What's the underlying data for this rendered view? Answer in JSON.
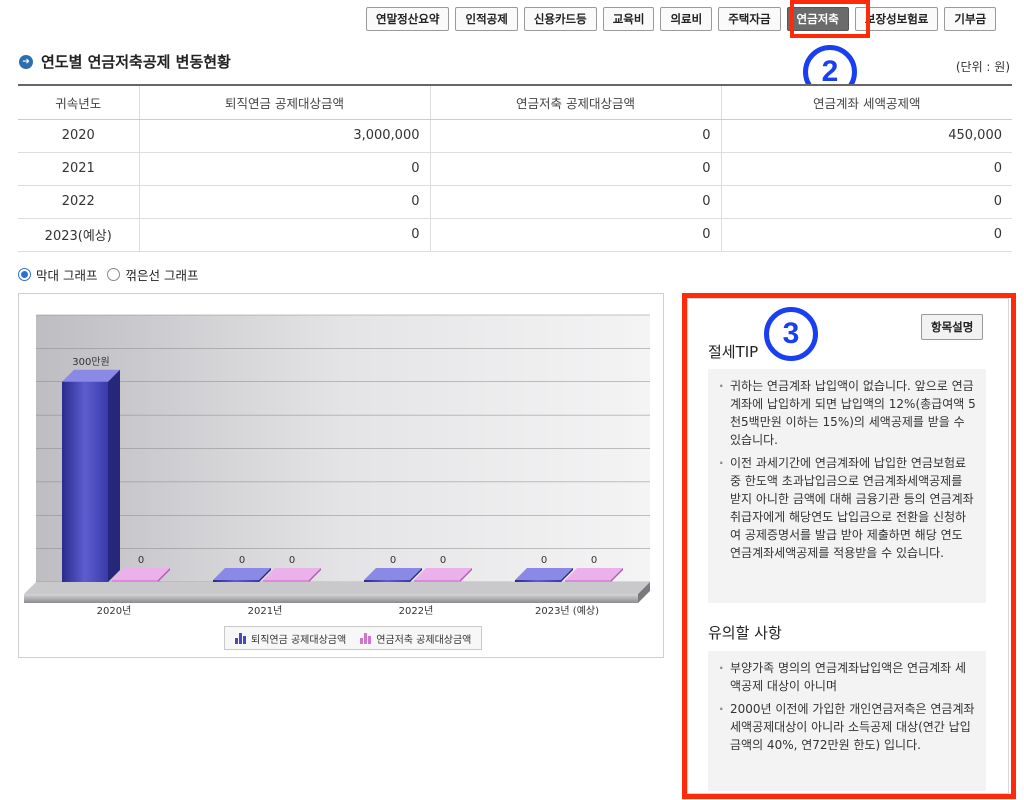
{
  "tabs": [
    {
      "label": "연말정산요약",
      "active": false
    },
    {
      "label": "인적공제",
      "active": false
    },
    {
      "label": "신용카드등",
      "active": false
    },
    {
      "label": "교육비",
      "active": false
    },
    {
      "label": "의료비",
      "active": false
    },
    {
      "label": "주택자금",
      "active": false
    },
    {
      "label": "연금저축",
      "active": true
    },
    {
      "label": "보장성보험료",
      "active": false
    },
    {
      "label": "기부금",
      "active": false
    }
  ],
  "annotations": {
    "step2": "2",
    "step3": "3",
    "highlight_color": "#ff2a0a",
    "badge_color": "#1a3ff0"
  },
  "section": {
    "title": "연도별 연금저축공제 변동현황",
    "unit": "(단위 : 원)"
  },
  "table": {
    "headers": [
      "귀속년도",
      "퇴직연금 공제대상금액",
      "연금저축 공제대상금액",
      "연금계좌 세액공제액"
    ],
    "rows": [
      [
        "2020",
        "3,000,000",
        "0",
        "450,000"
      ],
      [
        "2021",
        "0",
        "0",
        "0"
      ],
      [
        "2022",
        "0",
        "0",
        "0"
      ],
      [
        "2023(예상)",
        "0",
        "0",
        "0"
      ]
    ]
  },
  "graph_options": [
    {
      "label": "막대 그래프",
      "checked": true
    },
    {
      "label": "꺾은선 그래프",
      "checked": false
    }
  ],
  "chart_data": {
    "type": "bar",
    "categories": [
      "2020년",
      "2021년",
      "2022년",
      "2023년 (예상)"
    ],
    "series": [
      {
        "name": "퇴직연금 공제대상금액",
        "values": [
          300,
          0,
          0,
          0
        ],
        "labels": [
          "300만원",
          "0",
          "0",
          "0"
        ],
        "color": "#4a4ab8"
      },
      {
        "name": "연금저축 공제대상금액",
        "values": [
          0,
          0,
          0,
          0
        ],
        "labels": [
          "0",
          "0",
          "0",
          "0"
        ],
        "color": "#cc77cc"
      }
    ],
    "ylim": [
      0,
      400
    ],
    "grid": true,
    "legend": "bottom"
  },
  "tip": {
    "explain_button": "항목설명",
    "title": "절세TIP",
    "items": [
      "귀하는 연금계좌 납입액이 없습니다. 앞으로 연금계좌에 납입하게 되면 납입액의 12%(총급여액 5천5백만원 이하는 15%)의 세액공제를 받을 수 있습니다.",
      "이전 과세기간에 연금계좌에 납입한 연금보험료 중 한도액 초과납입금으로 연금계좌세액공제를 받지 아니한 금액에 대해 금융기관 등의 연금계좌 취급자에게 해당연도 납입금으로 전환을 신청하여 공제증명서를 발급 받아 제출하면 해당 연도 연금계좌세액공제를 적용받을 수 있습니다."
    ],
    "caution_title": "유의할 사항",
    "caution_items": [
      "부양가족 명의의 연금계좌납입액은 연금계좌 세액공제 대상이 아니며",
      "2000년 이전에 가입한 개인연금저축은 연금계좌세액공제대상이 아니라 소득공제 대상(연간 납입금액의 40%, 연72만원 한도) 입니다."
    ]
  }
}
